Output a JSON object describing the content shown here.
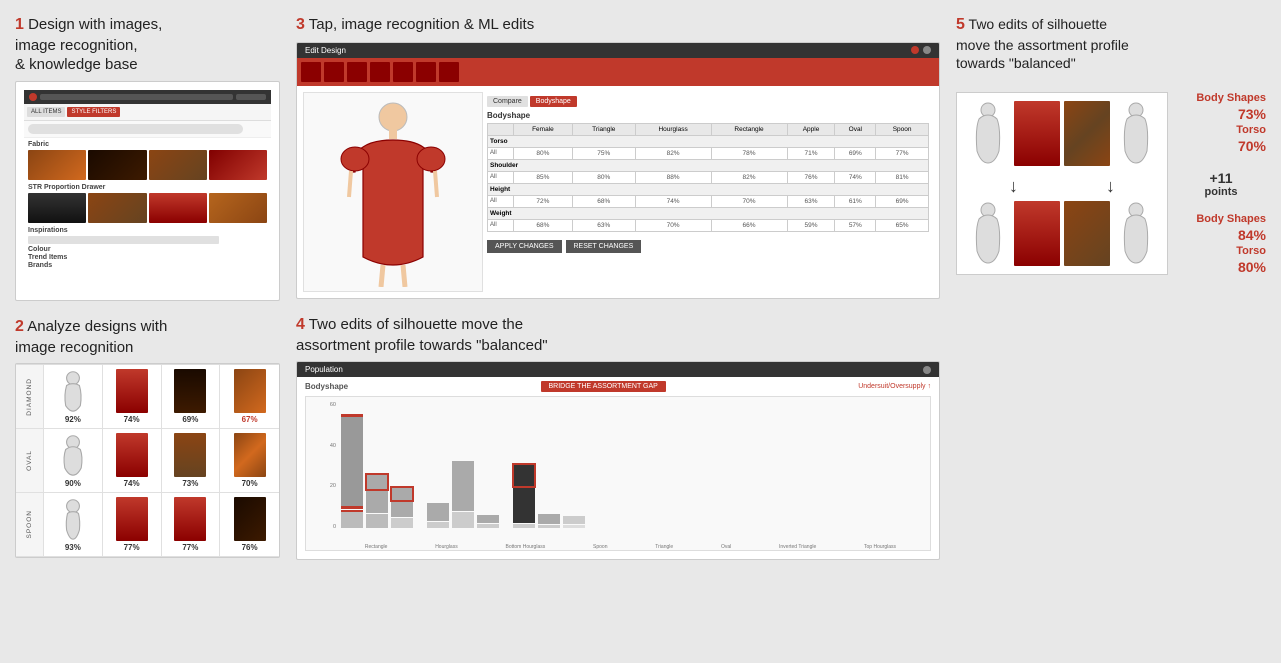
{
  "sections": {
    "s1": {
      "num": "1",
      "title": " Design with images,\nimage recognition,\n& knowledge base"
    },
    "s2": {
      "num": "2",
      "title": " Analyze designs with\nimage recognition"
    },
    "s3": {
      "num": "3",
      "title": " Tap, image recognition & ML edits"
    },
    "s4": {
      "num": "4",
      "title": "Two edits of silhouette move the\nassortment profile towards \"balanced\""
    },
    "s5": {
      "num": "5",
      "title": "Two edits of silhouette\nmove the assortment profile\ntowards \"balanced\""
    }
  },
  "analyze": {
    "rows": [
      {
        "label": "Diamond",
        "pcts": [
          "92%",
          "74%",
          "69%",
          "67%"
        ],
        "highlight": [
          false,
          false,
          false,
          false
        ]
      },
      {
        "label": "Oval",
        "pcts": [
          "90%",
          "74%",
          "73%",
          "70%"
        ],
        "highlight": [
          false,
          false,
          false,
          false
        ]
      },
      {
        "label": "Spoon",
        "pcts": [
          "93%",
          "77%",
          "77%",
          "76%"
        ],
        "highlight": [
          false,
          false,
          false,
          false
        ]
      }
    ]
  },
  "edit_design": {
    "header": "Edit Design",
    "table_title": "Bodyshape",
    "columns": [
      "Female",
      "Triangle",
      "Hourglass",
      "Rectangle",
      "Apple"
    ],
    "sections": [
      "Torso",
      "Shoulder",
      "Height",
      "Weight"
    ],
    "bridge": {
      "label": "Bodyshape",
      "badge": "BRIDGE THE ASSORTMENT GAP",
      "legend": "Undersuit/Oversupply"
    }
  },
  "right": {
    "top_stats": {
      "body_shapes_label": "Body Shapes",
      "body_shapes_pct": "73%",
      "torso_label": "Torso",
      "torso_pct": "70%"
    },
    "bottom_stats": {
      "body_shapes_label": "Body Shapes",
      "body_shapes_pct": "84%",
      "torso_label": "Torso",
      "torso_pct": "80%"
    },
    "plus_points": "+11",
    "points_label": "points"
  }
}
